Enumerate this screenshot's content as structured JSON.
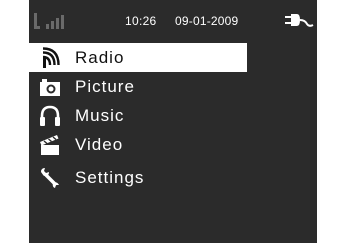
{
  "status_bar": {
    "time": "10:26",
    "date": "09-01-2009",
    "signal_icon": "signal-strength-icon",
    "power_icon": "power-plug-icon"
  },
  "menu": {
    "selected_index": 0,
    "items": [
      {
        "label": "Radio",
        "icon": "radio-antenna-icon"
      },
      {
        "label": "Picture",
        "icon": "camera-icon"
      },
      {
        "label": "Music",
        "icon": "headphones-icon"
      },
      {
        "label": "Video",
        "icon": "clapperboard-icon"
      },
      {
        "label": "Settings",
        "icon": "wrench-icon"
      }
    ]
  },
  "colors": {
    "screen_background": "#2b2b2b",
    "selection_background": "#ffffff",
    "text": "#ffffff",
    "selected_text": "#111111"
  }
}
